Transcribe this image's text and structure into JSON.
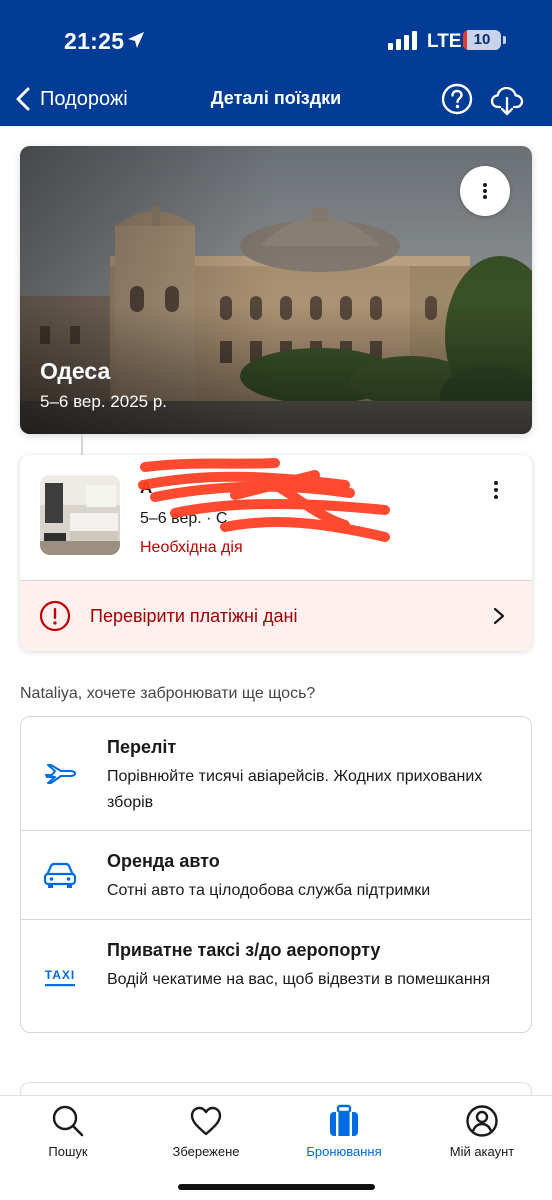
{
  "status_bar": {
    "time": "21:25",
    "network": "LTE",
    "battery": "10",
    "battery_level_percent": 10
  },
  "nav": {
    "back_label": "Подорожі",
    "title": "Деталі поїздки"
  },
  "trip": {
    "city": "Одеса",
    "dates": "5–6 вер. 2025 р."
  },
  "booking": {
    "name": "А",
    "dates": "5–6 вер. · С",
    "status": "Необхідна дія",
    "payment_label": "Перевірити платіжні дані"
  },
  "suggestions": {
    "title": "Nataliya, хочете забронювати ще щось?",
    "items": [
      {
        "icon": "plane-icon",
        "title": "Переліт",
        "desc": "Порівнюйте тисячі авіарейсів. Жодних прихованих зборів"
      },
      {
        "icon": "car-icon",
        "title": "Оренда авто",
        "desc": "Сотні авто та цілодобова служба підтримки"
      },
      {
        "icon": "taxi-icon",
        "title": "Приватне таксі з/до аеропорту",
        "desc": "Водій чекатиме на вас, щоб відвезти в помешкання",
        "icon_text": "TAXI"
      }
    ]
  },
  "tabs": [
    {
      "icon": "search-icon",
      "label": "Пошук"
    },
    {
      "icon": "heart-icon",
      "label": "Збережене"
    },
    {
      "icon": "suitcase-icon",
      "label": "Бронювання",
      "active": true
    },
    {
      "icon": "account-icon",
      "label": "Мій акаунт"
    }
  ],
  "colors": {
    "brand": "#003b95",
    "accent": "#006ce4",
    "alert": "#c00000"
  }
}
